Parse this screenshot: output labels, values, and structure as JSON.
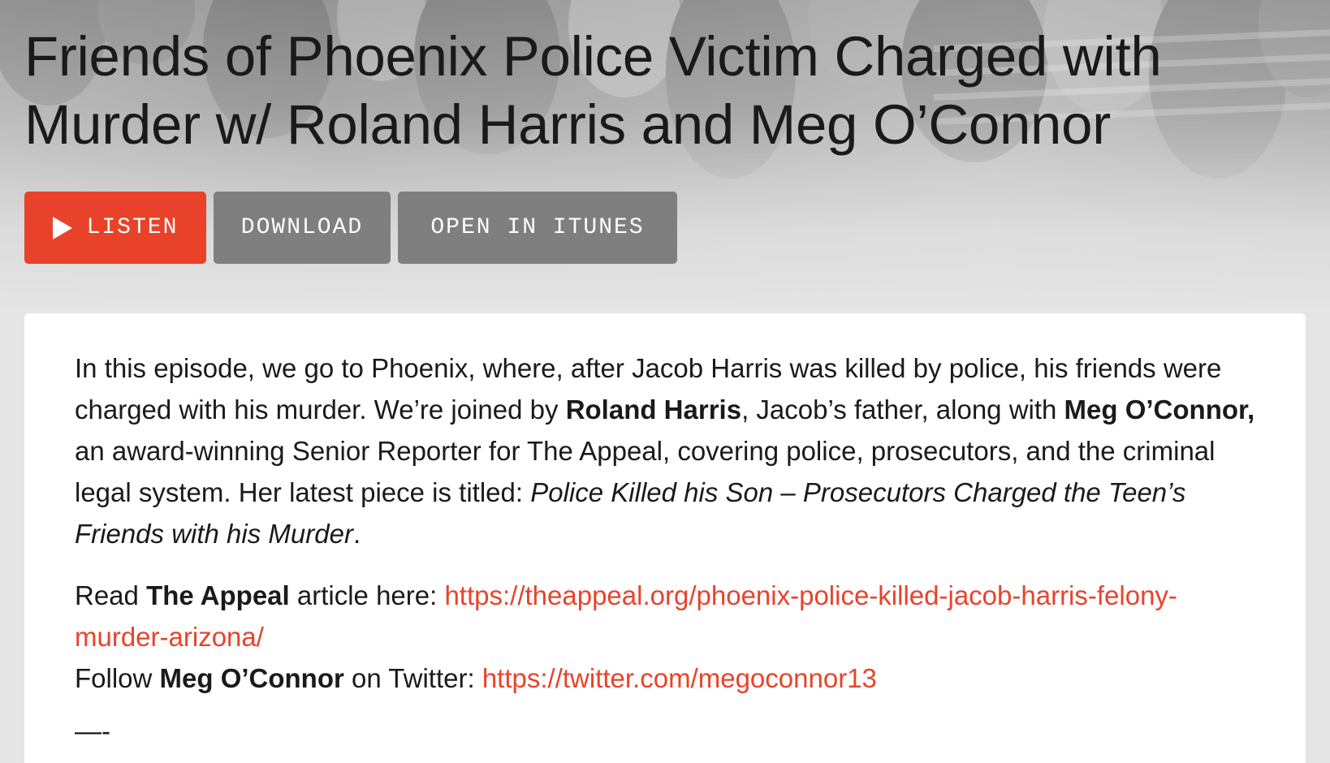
{
  "episode": {
    "title": "Friends of Phoenix Police Victim Charged with Murder w/ Roland Harris and Meg O’Connor"
  },
  "actions": {
    "listen_label": "LISTEN",
    "download_label": "DOWNLOAD",
    "itunes_label": "OPEN IN ITUNES"
  },
  "description": {
    "intro_1": "In this episode, we go to Phoenix, where, after Jacob Harris was killed by police, his friends were charged with his murder. We’re joined by ",
    "guest_1": "Roland Harris",
    "intro_2": ", Jacob’s father, along with ",
    "guest_2": "Meg O’Connor,",
    "intro_3": " an award-winning Senior Reporter for The Appeal, covering police, prosecutors, and the criminal legal system. Her latest piece is titled: ",
    "article_title": "Police Killed his Son – Prosecutors Charged the Teen’s Friends with his Murder",
    "intro_end": ".",
    "read_prefix": "Read ",
    "read_outlet": "The Appeal",
    "read_suffix": " article here: ",
    "article_url": "https://theappeal.org/phoenix-police-killed-jacob-harris-felony-murder-arizona/",
    "follow_prefix": "Follow ",
    "follow_name": "Meg O’Connor",
    "follow_suffix": " on Twitter: ",
    "twitter_url": "https://twitter.com/megoconnor13",
    "divider": "—-"
  },
  "colors": {
    "accent": "#e8432a",
    "secondary_button": "#7f7f7f",
    "page_background": "#e5e5e5",
    "text": "#1a1a1a"
  },
  "icons": {
    "listen": "play-icon"
  }
}
